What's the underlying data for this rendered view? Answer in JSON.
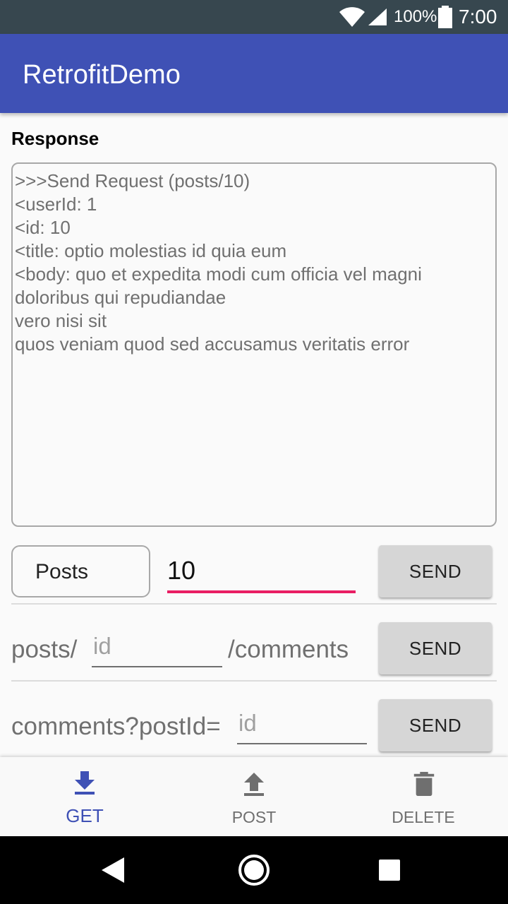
{
  "status_bar": {
    "battery_pct": "100%",
    "time": "7:00"
  },
  "app_bar": {
    "title": "RetrofitDemo"
  },
  "response": {
    "label": "Response",
    "text": ">>>Send Request (posts/10)\n<userId: 1\n<id: 10\n<title: optio molestias id quia eum\n<body: quo et expedita modi cum officia vel magni doloribus qui repudiandae\nvero nisi sit\nquos veniam quod sed accusamus veritatis error"
  },
  "row1": {
    "spinner_value": "Posts",
    "input_value": "10",
    "send_label": "SEND"
  },
  "row2": {
    "prefix": "posts/",
    "input_placeholder": "id",
    "suffix": "/comments",
    "send_label": "SEND"
  },
  "row3": {
    "prefix": "comments?postId=",
    "input_placeholder": "id",
    "send_label": "SEND"
  },
  "bottom_nav": {
    "items": [
      {
        "label": "GET",
        "icon": "download-icon",
        "active": true
      },
      {
        "label": "POST",
        "icon": "upload-icon",
        "active": false
      },
      {
        "label": "DELETE",
        "icon": "trash-icon",
        "active": false
      }
    ]
  },
  "colors": {
    "primary": "#3f51b5",
    "accent": "#e91e63",
    "status_bar": "#37474f"
  }
}
